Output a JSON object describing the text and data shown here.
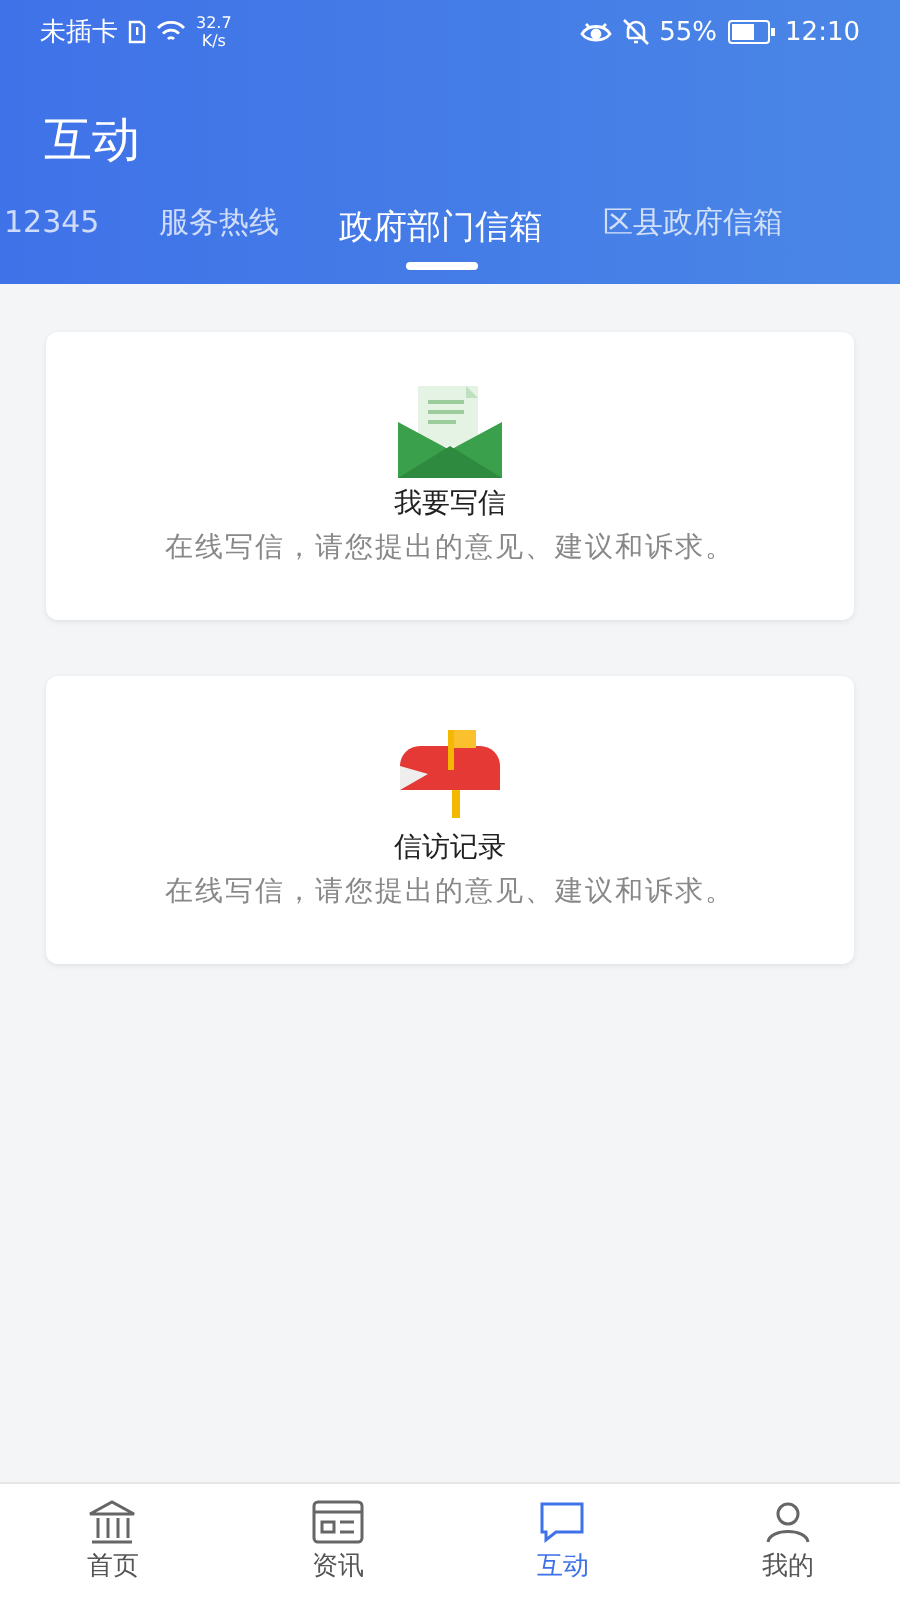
{
  "status_bar": {
    "carrier": "未插卡",
    "speed_value": "32.7",
    "speed_unit": "K/s",
    "battery": "55%",
    "time": "12:10"
  },
  "header": {
    "title": "互动"
  },
  "tabs": [
    {
      "label": "12345",
      "selected": false
    },
    {
      "label": "服务热线",
      "selected": false
    },
    {
      "label": "政府部门信箱",
      "selected": true
    },
    {
      "label": "区县政府信箱",
      "selected": false
    }
  ],
  "cards": [
    {
      "kind": "letter",
      "title": "我要写信",
      "description": "在线写信，请您提出的意见、建议和诉求。"
    },
    {
      "kind": "mailbox",
      "title": "信访记录",
      "description": "在线写信，请您提出的意见、建议和诉求。"
    }
  ],
  "bottom_nav": [
    {
      "kind": "home",
      "label": "首页",
      "selected": false
    },
    {
      "kind": "news",
      "label": "资讯",
      "selected": false
    },
    {
      "kind": "chat",
      "label": "互动",
      "selected": true
    },
    {
      "kind": "user",
      "label": "我的",
      "selected": false
    }
  ]
}
